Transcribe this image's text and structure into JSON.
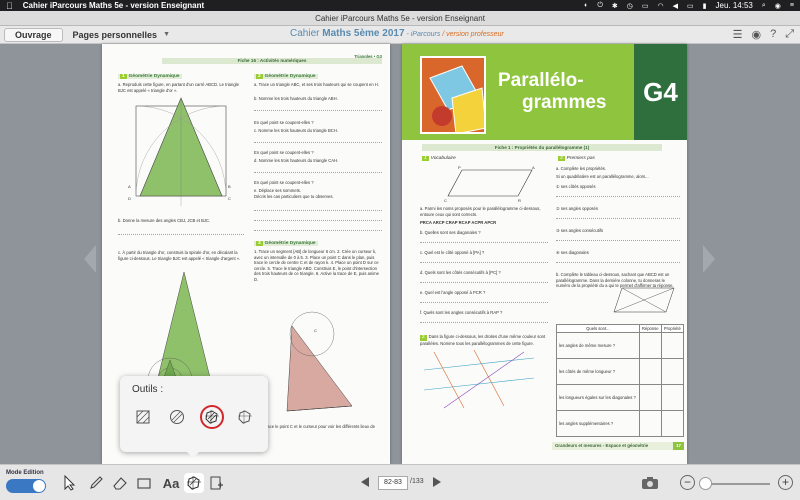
{
  "menubar": {
    "app_name": "Cahier iParcours Maths 5e - version Enseignant",
    "clock": "Jeu. 14:53"
  },
  "window": {
    "title": "Cahier iParcours Maths 5e - version Enseignant"
  },
  "toolbar": {
    "tab_active": "Ouvrage",
    "tab_other": "Pages personnelles",
    "doc_title_prefix": "Cahier ",
    "doc_title_bold": "Maths 5ème 2017",
    "doc_title_sub": " - iParcours",
    "doc_title_prof": " / version professeur"
  },
  "left_page": {
    "header_right": "Triangles • G3",
    "fiche": "Fiche 16 : Activités numériques",
    "s1_num": "1",
    "s1_title": "Géométrie Dynamique",
    "s1_a": "a. Reproduis cette figure, en partant d'un carré ABCD. Le triangle BJC est appelé « triangle d'or ».",
    "s1_b": "b. Donne la mesure des angles CBJ, JCB et BJC.",
    "s1_c": "c. À partir du triangle d'or, construis la spirale d'or, en décalant la figure ci-dessous. Le triangle BJC est appelé « triangle d'argent ».",
    "s2_num": "2",
    "s2_title": "Géométrie Dynamique",
    "s2_a": "a. Trace un triangle ABC, et ses trois hauteurs qui se coupent en H.",
    "s2_b": "b. Nomme les trois hauteurs du triangle ABH.",
    "s2_q1": "En quel point se coupent-elles ?",
    "s2_c": "c. Nomme les trois hauteurs du triangle BCH.",
    "s2_q2": "En quel point se coupent-elles ?",
    "s2_d": "d. Nomme les trois hauteurs du triangle CAH.",
    "s2_q3": "En quel point se coupent-elles ?",
    "s2_e": "e. Déplace ses sommets.",
    "s2_e2": "Décris les cas particuliers que tu observes.",
    "s3_num": "3",
    "s3_title": "Géométrie Dynamique",
    "s3_steps": "1. Trace un segment [AB] de longueur 6 cm. 2. Crée un curseur k, avec un intervalle de 0 à 5. 3. Place un point C dans le plan, puis trace le cercle de centre C et de rayon k. 4. Place un point D sur ce cercle. 5. Trace le triangle ABD. Construis E, le point d'intersection des trois hauteurs de ce triangle. 6. Active la trace de E, puis anime D.",
    "s3_end": "7. Déplace le point C et le curseur pour voir les différents lieux de points."
  },
  "right_page": {
    "chapter_line1": "Parallélo-",
    "chapter_line2": "grammes",
    "chapter_code": "G4",
    "fiche": "Fiche 1 : Propriétés du parallélogramme (1)",
    "s1_num": "1",
    "s1_title": "Vocabulaire",
    "s1_a": "a. Parmi les noms proposés pour le parallélogramme ci-dessous, entoure ceux qui sont corrects.",
    "s1_names": "PRCA   ARCP   CRAP   RCAP   ACPR   APCR",
    "s1_b": "b. Quelles sont ses diagonales ?",
    "s1_c": "c. Quel est le côté opposé à [PA] ?",
    "s1_d": "d. Quels sont les côtés consécutifs à [PC] ?",
    "s1_e": "e. Quel est l'angle opposé à PCR ?",
    "s1_f": "f. Quels sont les angles consécutifs à RAP ?",
    "s2_num": "2",
    "s2_text": "Dans la figure ci-dessous, les droites d'une même couleur sont parallèles. Nomme tous les parallélogrammes de cette figure.",
    "s3_num": "3",
    "s3_title": "Premiers pas",
    "s3_a": "a. Complète les propriétés.",
    "s3_a1": "Si un quadrilatère est un parallélogramme, alors...",
    "s3_o1": "ses côtés opposés",
    "s3_o2": "ses angles opposés",
    "s3_o3": "ses angles consécutifs",
    "s3_o4": "ses diagonales",
    "s3_b": "b. Complète le tableau ci-dessous, sachant que ABCD est un parallélogramme. Dans la dernière colonne, tu donneras le numéro de la propriété du a qui te permet d'affirmer ta réponse.",
    "table_headers": [
      "Quels sont...",
      "Réponse",
      "Propriété"
    ],
    "table_rows": [
      "les angles de même mesure ?",
      "les côtés de même longueur ?",
      "les longueurs égales sur les diagonales ?",
      "les angles supplémentaires ?"
    ],
    "footer": "Grandeurs et mesures - Espace et géométrie",
    "page_number": "17"
  },
  "popup": {
    "title": "Outils :"
  },
  "bottombar": {
    "mode_label": "Mode Edition",
    "text_tool": "Aa",
    "page_value": "82-83",
    "page_total": "/133"
  },
  "colors": {
    "green": "#8fc43e",
    "dark_green": "#2f6f3e",
    "accent_blue": "#3b78c4",
    "selected_red": "#d0282a"
  }
}
